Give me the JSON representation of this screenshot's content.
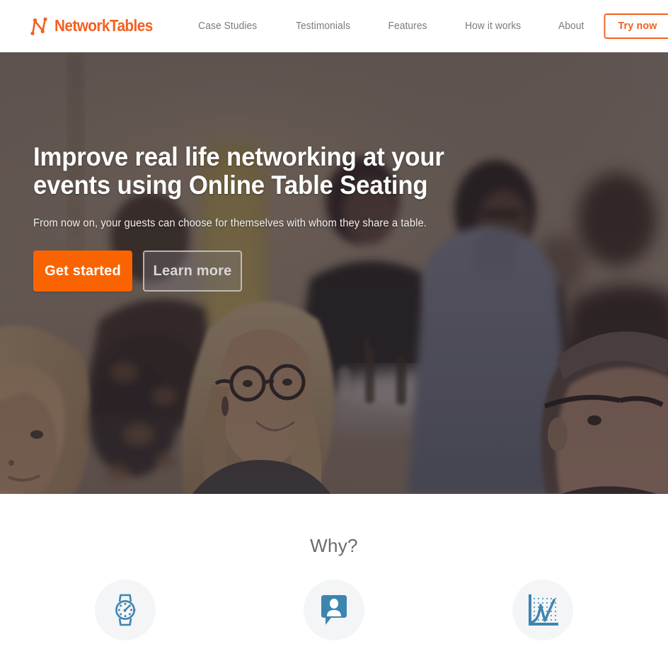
{
  "brand": {
    "name": "NetworkTables",
    "logo_icon": "network-n-logo-icon",
    "color": "#f4601e"
  },
  "nav": {
    "items": [
      {
        "label": "Case Studies",
        "name": "nav-link-case-studies"
      },
      {
        "label": "Testimonials",
        "name": "nav-link-testimonials"
      },
      {
        "label": "Features",
        "name": "nav-link-features"
      },
      {
        "label": "How it works",
        "name": "nav-link-how-it-works"
      },
      {
        "label": "About",
        "name": "nav-link-about"
      }
    ],
    "cta_label": "Try now"
  },
  "hero": {
    "title": "Improve real life networking at your events using Online Table Seating",
    "subtitle": "From now on, your guests can choose for themselves with whom they share a table.",
    "primary_button": "Get started",
    "secondary_button": "Learn more",
    "background": "photo of people seated and talking at an event dinner table",
    "overlay_color": "#2a2228"
  },
  "why": {
    "heading": "Why?",
    "items": [
      {
        "icon": "wristwatch-icon",
        "icon_color": "#3d85b0"
      },
      {
        "icon": "speech-bubble-person-icon",
        "icon_color": "#3d85b0"
      },
      {
        "icon": "line-chart-icon",
        "icon_color": "#3d85b0"
      }
    ]
  },
  "colors": {
    "accent_orange": "#fa6400",
    "brand_orange": "#f4601e",
    "nav_text": "#7b7b7b",
    "icon_blue": "#3d85b0",
    "icon_circle_bg": "#f4f5f6",
    "heading_gray": "#6b6b6b"
  }
}
